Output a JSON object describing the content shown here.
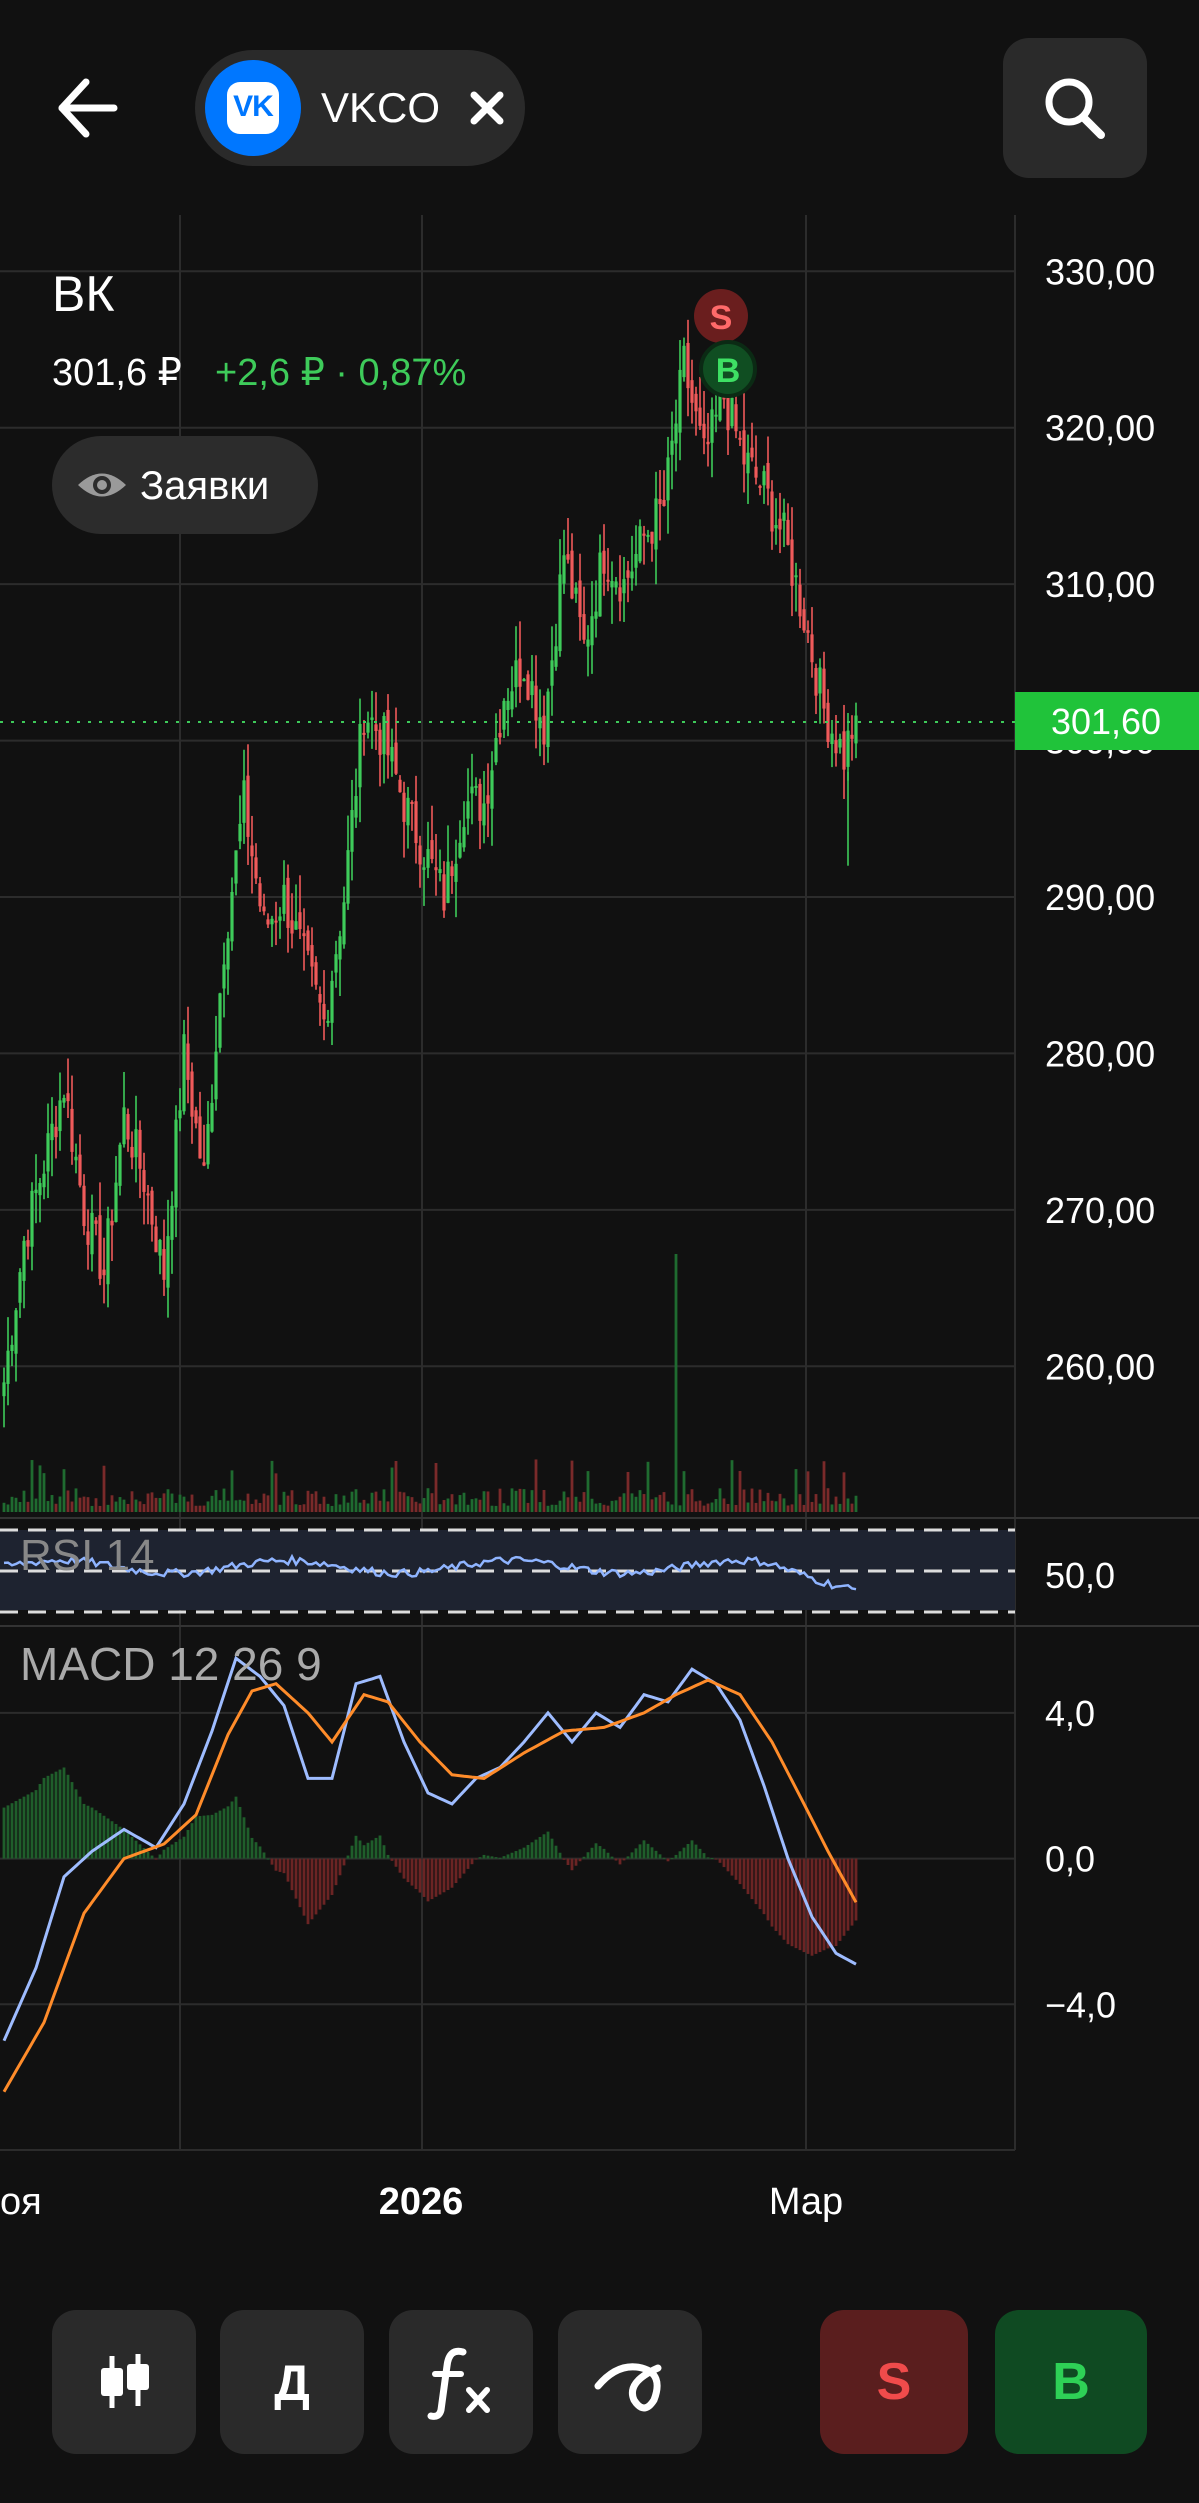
{
  "header": {
    "ticker": "VKCO",
    "logo_text": "VK"
  },
  "instrument": {
    "name": "ВК",
    "price": "301,6 ₽",
    "change": "+2,6 ₽ · 0,87%",
    "orders_label": "Заявки"
  },
  "markers": {
    "sell": "S",
    "buy": "B"
  },
  "toolbar": {
    "period_label": "Д",
    "sell_label": "S",
    "buy_label": "B"
  },
  "colors": {
    "up": "#3ecb5a",
    "down": "#ef5a5a",
    "rsi_line": "#8fb4ff",
    "macd_line": "#9ebcff",
    "signal_line": "#ff8c2a",
    "last_price_tag": "#20c33a"
  },
  "chart_data": {
    "type": "candlestick",
    "x_labels": [
      "оя",
      "2026",
      "Мар"
    ],
    "y_ticks": [
      "330,00",
      "320,00",
      "310,00",
      "300,00",
      "290,00",
      "280,00",
      "270,00",
      "260,00"
    ],
    "y_range": [
      250.3,
      332
    ],
    "last_price": 301.6,
    "last_price_label": "301,60",
    "price_anchors": [
      [
        0,
        259
      ],
      [
        5,
        268
      ],
      [
        10,
        273
      ],
      [
        15,
        278
      ],
      [
        20,
        270
      ],
      [
        25,
        266
      ],
      [
        30,
        276
      ],
      [
        35,
        272
      ],
      [
        40,
        266
      ],
      [
        45,
        280
      ],
      [
        50,
        272
      ],
      [
        55,
        287
      ],
      [
        60,
        296
      ],
      [
        65,
        288
      ],
      [
        70,
        290
      ],
      [
        75,
        286
      ],
      [
        80,
        282
      ],
      [
        85,
        290
      ],
      [
        90,
        302
      ],
      [
        95,
        300
      ],
      [
        100,
        296
      ],
      [
        105,
        293
      ],
      [
        110,
        290
      ],
      [
        115,
        296
      ],
      [
        120,
        296
      ],
      [
        125,
        303
      ],
      [
        130,
        305
      ],
      [
        135,
        301
      ],
      [
        140,
        312
      ],
      [
        145,
        306
      ],
      [
        150,
        312
      ],
      [
        155,
        310
      ],
      [
        160,
        313
      ],
      [
        165,
        315
      ],
      [
        170,
        324
      ],
      [
        175,
        318
      ],
      [
        180,
        322
      ],
      [
        185,
        318
      ],
      [
        190,
        316
      ],
      [
        195,
        313
      ],
      [
        200,
        308
      ],
      [
        205,
        302
      ],
      [
        210,
        299
      ],
      [
        213,
        301.6
      ]
    ],
    "volume_spike_index": 168,
    "rsi": {
      "label": "RSI 14",
      "tick": "50,0",
      "levels": [
        30,
        50,
        70
      ],
      "range": [
        25,
        75
      ]
    },
    "macd": {
      "label": "MACD 12 26 9",
      "ticks": [
        "4,0",
        "0,0",
        "−4,0"
      ],
      "range": [
        -8.0,
        6.0
      ],
      "macd_anchors": [
        [
          0,
          -5.0
        ],
        [
          8,
          -3.0
        ],
        [
          15,
          -0.5
        ],
        [
          22,
          0.2
        ],
        [
          30,
          0.8
        ],
        [
          38,
          0.3
        ],
        [
          45,
          1.5
        ],
        [
          52,
          3.5
        ],
        [
          58,
          5.5
        ],
        [
          64,
          5.0
        ],
        [
          70,
          4.2
        ],
        [
          76,
          2.2
        ],
        [
          82,
          2.2
        ],
        [
          88,
          4.8
        ],
        [
          94,
          5.0
        ],
        [
          100,
          3.2
        ],
        [
          106,
          1.8
        ],
        [
          112,
          1.5
        ],
        [
          118,
          2.2
        ],
        [
          124,
          2.5
        ],
        [
          130,
          3.2
        ],
        [
          136,
          4.0
        ],
        [
          142,
          3.2
        ],
        [
          148,
          4.0
        ],
        [
          154,
          3.6
        ],
        [
          160,
          4.5
        ],
        [
          166,
          4.3
        ],
        [
          172,
          5.2
        ],
        [
          178,
          4.8
        ],
        [
          184,
          3.8
        ],
        [
          190,
          2.0
        ],
        [
          196,
          0.0
        ],
        [
          202,
          -1.6
        ],
        [
          208,
          -2.6
        ],
        [
          213,
          -2.9
        ]
      ],
      "signal_anchors": [
        [
          0,
          -6.4
        ],
        [
          10,
          -4.5
        ],
        [
          20,
          -1.5
        ],
        [
          30,
          0.0
        ],
        [
          40,
          0.4
        ],
        [
          48,
          1.2
        ],
        [
          56,
          3.4
        ],
        [
          62,
          4.6
        ],
        [
          68,
          4.8
        ],
        [
          76,
          4.0
        ],
        [
          82,
          3.2
        ],
        [
          90,
          4.5
        ],
        [
          96,
          4.3
        ],
        [
          104,
          3.2
        ],
        [
          112,
          2.3
        ],
        [
          120,
          2.2
        ],
        [
          130,
          2.9
        ],
        [
          140,
          3.5
        ],
        [
          150,
          3.6
        ],
        [
          160,
          4.0
        ],
        [
          168,
          4.5
        ],
        [
          176,
          4.9
        ],
        [
          184,
          4.5
        ],
        [
          192,
          3.2
        ],
        [
          200,
          1.5
        ],
        [
          206,
          0.2
        ],
        [
          213,
          -1.2
        ]
      ]
    }
  }
}
